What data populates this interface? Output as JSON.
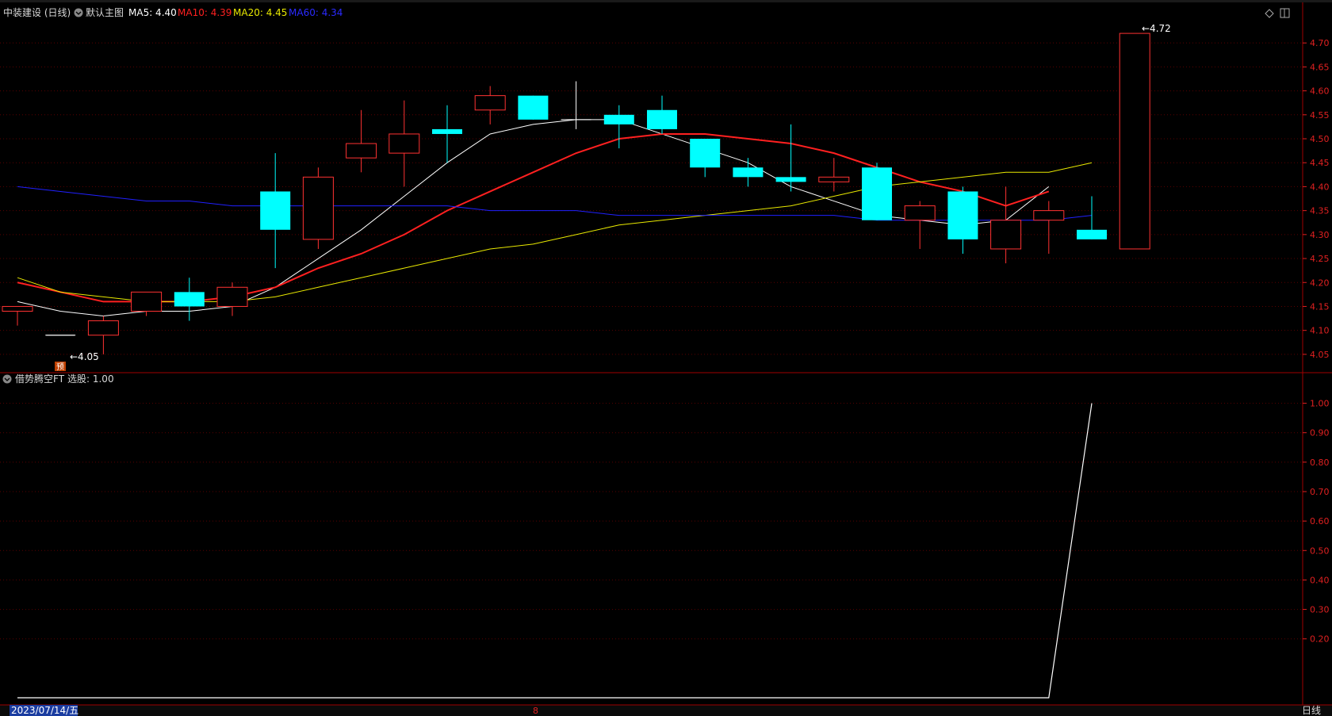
{
  "header": {
    "stock": "中装建设 (日线)",
    "template": "默认主图",
    "ma_items": [
      {
        "label": "MA5: 4.40",
        "color": "#ffffff"
      },
      {
        "label": "MA10: 4.39",
        "color": "#ff2020"
      },
      {
        "label": "MA20: 4.45",
        "color": "#e8e800"
      },
      {
        "label": "MA60: 4.34",
        "color": "#2020ff"
      }
    ]
  },
  "indicator_header": {
    "name": "借势腾空FT",
    "value_label": "选股: 1.00"
  },
  "footer": {
    "date_label": "2023/07/14/五",
    "marker": "8",
    "period": "日线"
  },
  "annotations": {
    "low_label": "←4.05",
    "high_label": "←4.72",
    "forecast_badge": "预"
  },
  "colors": {
    "up": "#ff3232",
    "down": "#00ffff",
    "axis": "#e02020",
    "grid": "#5a0000"
  },
  "chart_data": [
    {
      "type": "candlestick",
      "ylim": [
        4.02,
        4.74
      ],
      "yticks": [
        "4.05",
        "4.10",
        "4.15",
        "4.20",
        "4.25",
        "4.30",
        "4.35",
        "4.40",
        "4.45",
        "4.50",
        "4.55",
        "4.60",
        "4.65",
        "4.70"
      ],
      "candles": [
        {
          "o": 4.14,
          "h": 4.15,
          "l": 4.11,
          "c": 4.15,
          "dir": "up"
        },
        {
          "o": 4.09,
          "h": 4.09,
          "l": 4.09,
          "c": 4.09,
          "dir": "flat"
        },
        {
          "o": 4.09,
          "h": 4.13,
          "l": 4.05,
          "c": 4.12,
          "dir": "up"
        },
        {
          "o": 4.14,
          "h": 4.18,
          "l": 4.13,
          "c": 4.18,
          "dir": "up"
        },
        {
          "o": 4.18,
          "h": 4.21,
          "l": 4.12,
          "c": 4.15,
          "dir": "down"
        },
        {
          "o": 4.15,
          "h": 4.2,
          "l": 4.13,
          "c": 4.19,
          "dir": "up"
        },
        {
          "o": 4.39,
          "h": 4.47,
          "l": 4.23,
          "c": 4.31,
          "dir": "down"
        },
        {
          "o": 4.29,
          "h": 4.44,
          "l": 4.27,
          "c": 4.42,
          "dir": "up"
        },
        {
          "o": 4.46,
          "h": 4.56,
          "l": 4.43,
          "c": 4.49,
          "dir": "up"
        },
        {
          "o": 4.47,
          "h": 4.58,
          "l": 4.4,
          "c": 4.51,
          "dir": "up"
        },
        {
          "o": 4.52,
          "h": 4.57,
          "l": 4.45,
          "c": 4.51,
          "dir": "down"
        },
        {
          "o": 4.56,
          "h": 4.61,
          "l": 4.53,
          "c": 4.59,
          "dir": "up"
        },
        {
          "o": 4.59,
          "h": 4.59,
          "l": 4.54,
          "c": 4.54,
          "dir": "down"
        },
        {
          "o": 4.54,
          "h": 4.62,
          "l": 4.52,
          "c": 4.54,
          "dir": "flat"
        },
        {
          "o": 4.55,
          "h": 4.57,
          "l": 4.48,
          "c": 4.53,
          "dir": "down"
        },
        {
          "o": 4.56,
          "h": 4.59,
          "l": 4.51,
          "c": 4.52,
          "dir": "down"
        },
        {
          "o": 4.5,
          "h": 4.5,
          "l": 4.42,
          "c": 4.44,
          "dir": "down"
        },
        {
          "o": 4.44,
          "h": 4.46,
          "l": 4.4,
          "c": 4.42,
          "dir": "down"
        },
        {
          "o": 4.42,
          "h": 4.53,
          "l": 4.39,
          "c": 4.41,
          "dir": "down"
        },
        {
          "o": 4.41,
          "h": 4.46,
          "l": 4.39,
          "c": 4.42,
          "dir": "up"
        },
        {
          "o": 4.44,
          "h": 4.45,
          "l": 4.33,
          "c": 4.33,
          "dir": "down"
        },
        {
          "o": 4.33,
          "h": 4.37,
          "l": 4.27,
          "c": 4.36,
          "dir": "up"
        },
        {
          "o": 4.39,
          "h": 4.4,
          "l": 4.26,
          "c": 4.29,
          "dir": "down"
        },
        {
          "o": 4.27,
          "h": 4.4,
          "l": 4.24,
          "c": 4.33,
          "dir": "up"
        },
        {
          "o": 4.33,
          "h": 4.37,
          "l": 4.26,
          "c": 4.35,
          "dir": "up"
        },
        {
          "o": 4.31,
          "h": 4.38,
          "l": 4.29,
          "c": 4.29,
          "dir": "down"
        },
        {
          "o": 4.27,
          "h": 4.72,
          "l": 4.27,
          "c": 4.72,
          "dir": "up"
        }
      ],
      "ma": [
        {
          "name": "MA5",
          "color": "#ffffff",
          "width": 1,
          "values": [
            4.16,
            4.14,
            4.13,
            4.14,
            4.14,
            4.15,
            4.19,
            4.25,
            4.31,
            4.38,
            4.45,
            4.51,
            4.53,
            4.54,
            4.54,
            4.51,
            4.48,
            4.45,
            4.4,
            4.37,
            4.34,
            4.33,
            4.32,
            4.33,
            4.4
          ]
        },
        {
          "name": "MA10",
          "color": "#ff2020",
          "width": 2,
          "values": [
            4.2,
            4.18,
            4.16,
            4.16,
            4.16,
            4.17,
            4.19,
            4.23,
            4.26,
            4.3,
            4.35,
            4.39,
            4.43,
            4.47,
            4.5,
            4.51,
            4.51,
            4.5,
            4.49,
            4.47,
            4.44,
            4.41,
            4.39,
            4.36,
            4.39
          ]
        },
        {
          "name": "MA20",
          "color": "#e8e800",
          "width": 1,
          "values": [
            4.21,
            4.18,
            4.17,
            4.16,
            4.16,
            4.16,
            4.17,
            4.19,
            4.21,
            4.23,
            4.25,
            4.27,
            4.28,
            4.3,
            4.32,
            4.33,
            4.34,
            4.35,
            4.36,
            4.38,
            4.4,
            4.41,
            4.42,
            4.43,
            4.43,
            4.45
          ]
        },
        {
          "name": "MA60",
          "color": "#2020ff",
          "width": 1,
          "values": [
            4.4,
            4.39,
            4.38,
            4.37,
            4.37,
            4.36,
            4.36,
            4.36,
            4.36,
            4.36,
            4.36,
            4.35,
            4.35,
            4.35,
            4.34,
            4.34,
            4.34,
            4.34,
            4.34,
            4.34,
            4.33,
            4.33,
            4.33,
            4.33,
            4.33,
            4.34
          ]
        }
      ]
    },
    {
      "type": "line",
      "title": "借势腾空FT",
      "ylim": [
        0.0,
        1.05
      ],
      "yticks": [
        "0.20",
        "0.30",
        "0.40",
        "0.50",
        "0.60",
        "0.70",
        "0.80",
        "0.90",
        "1.00"
      ],
      "series": [
        {
          "values": [
            0,
            0,
            0,
            0,
            0,
            0,
            0,
            0,
            0,
            0,
            0,
            0,
            0,
            0,
            0,
            0,
            0,
            0,
            0,
            0,
            0,
            0,
            0,
            0,
            0,
            1
          ]
        }
      ]
    }
  ]
}
